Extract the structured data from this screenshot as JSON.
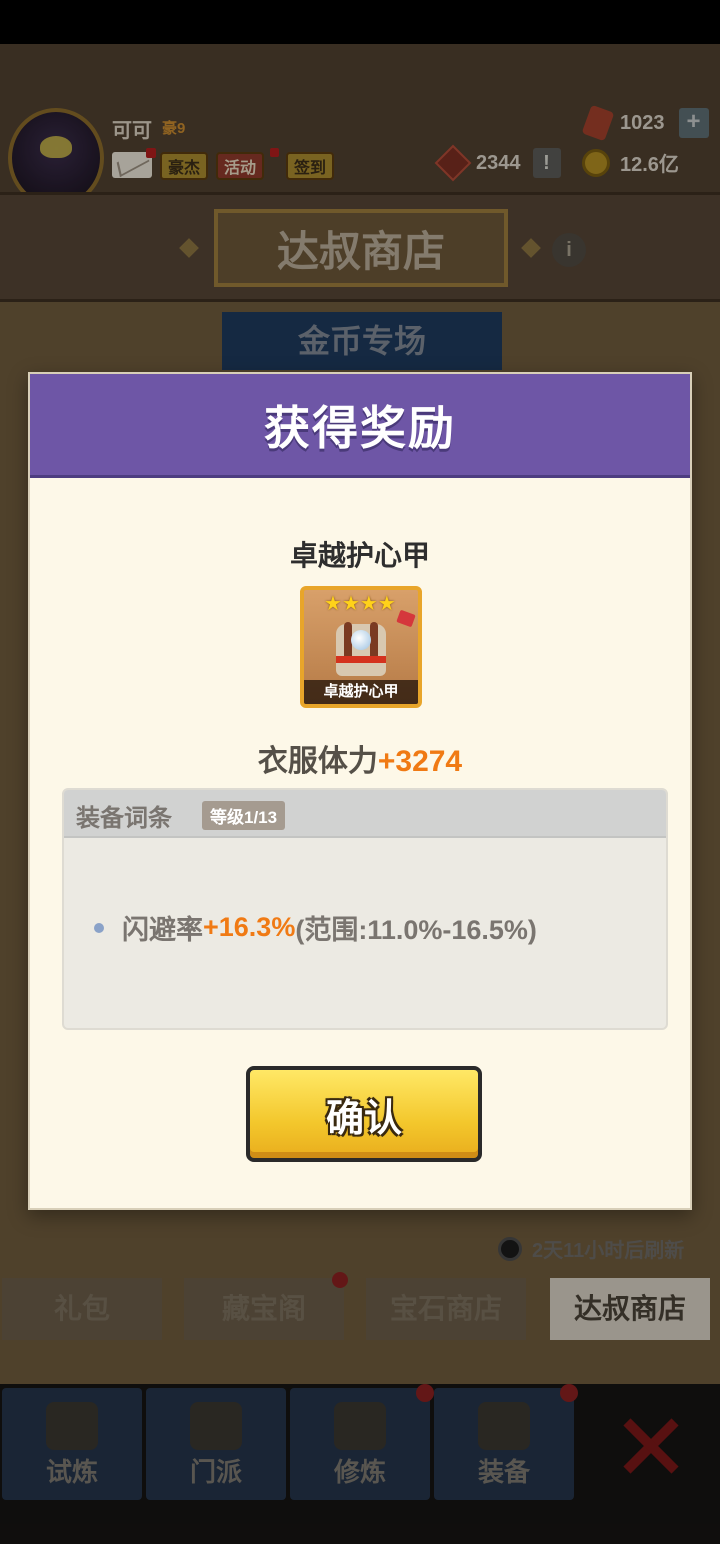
{
  "player": {
    "name": "可可",
    "vip": "豪9"
  },
  "header_buttons": [
    "豪杰",
    "活动",
    "签到"
  ],
  "resources": {
    "gems": "1023",
    "tokens": "2344",
    "gold": "12.6亿"
  },
  "shop": {
    "title": "达叔商店",
    "section": "金币专场",
    "refresh_text": "2天11小时后刷新"
  },
  "shop_tabs": [
    {
      "label": "礼包",
      "active": false
    },
    {
      "label": "藏宝阁",
      "active": false
    },
    {
      "label": "宝石商店",
      "active": false
    },
    {
      "label": "达叔商店",
      "active": true
    }
  ],
  "bottom_nav": [
    "试炼",
    "门派",
    "修炼",
    "装备"
  ],
  "dialog": {
    "title": "获得奖励",
    "item_name": "卓越护心甲",
    "item_stars": 4,
    "item_caption": "卓越护心甲",
    "stat_label": "衣服体力",
    "stat_value": "+3274",
    "affix_title": "装备词条",
    "affix_level": "等级1/13",
    "affix_label": "闪避率",
    "affix_value": "+16.3%",
    "affix_range": "(范围:11.0%-16.5%)",
    "confirm_label": "确认"
  },
  "colors": {
    "dialog_header": "#6e56a6",
    "accent_orange": "#f07a14",
    "confirm_yellow": "#f3c72c"
  }
}
